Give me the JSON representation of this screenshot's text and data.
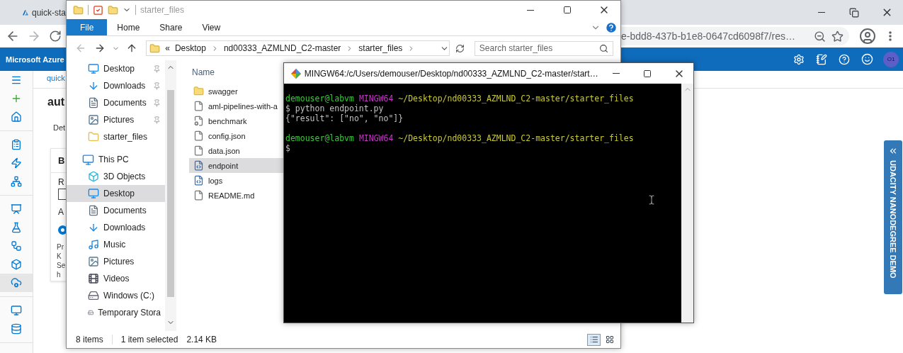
{
  "browser": {
    "tab_title": "quick-sta",
    "address": "e-bdd8-437b-b1e8-0647cd6098f7/res…"
  },
  "azure": {
    "brand": "Microsoft Azure",
    "avatar": "O1",
    "rail": [
      [
        {
          "selected": false
        },
        {
          "selected": false
        },
        {
          "selected": false
        }
      ],
      [
        {
          "selected": false
        },
        {
          "selected": false
        },
        {
          "selected": false
        }
      ],
      [
        {
          "selected": false
        },
        {
          "selected": false
        },
        {
          "selected": false
        },
        {
          "selected": false
        },
        {
          "selected": true
        }
      ],
      [
        {
          "selected": false
        },
        {
          "selected": false
        }
      ]
    ],
    "page": {
      "breadcrumb": "quick",
      "title": "aut",
      "tab": "Det",
      "card": {
        "title": "B",
        "field_label": "R",
        "option_label": "A",
        "radio": {
          "selected": true
        },
        "lines": [
          "Pr",
          "K",
          "Se",
          "h"
        ]
      }
    }
  },
  "udacity_tab": {
    "label": "UDACITY NANODEGREE DEMO"
  },
  "explorer": {
    "title": "starter_files",
    "ribbon_tabs": [
      {
        "label": "File",
        "selected": true
      },
      {
        "label": "Home",
        "selected": false
      },
      {
        "label": "Share",
        "selected": false
      },
      {
        "label": "View",
        "selected": false
      }
    ],
    "address": {
      "overflow": "«",
      "crumbs": [
        "Desktop",
        "nd00333_AZMLND_C2-master",
        "starter_files"
      ]
    },
    "search": {
      "placeholder": "Search starter_files"
    },
    "quick_access": [
      {
        "label": "Desktop",
        "kind": "desktop",
        "pinned": true,
        "selected": false
      },
      {
        "label": "Downloads",
        "kind": "download",
        "pinned": true,
        "selected": false
      },
      {
        "label": "Documents",
        "kind": "document",
        "pinned": true,
        "selected": false
      },
      {
        "label": "Pictures",
        "kind": "picture",
        "pinned": true,
        "selected": false
      },
      {
        "label": "starter_files",
        "kind": "folder",
        "pinned": false,
        "selected": false
      }
    ],
    "this_pc": {
      "label": "This PC",
      "selected": false,
      "children": [
        {
          "label": "3D Objects",
          "kind": "objects",
          "selected": false
        },
        {
          "label": "Desktop",
          "kind": "desktop",
          "selected": true
        },
        {
          "label": "Documents",
          "kind": "document",
          "selected": false
        },
        {
          "label": "Downloads",
          "kind": "download",
          "selected": false
        },
        {
          "label": "Music",
          "kind": "music",
          "selected": false
        },
        {
          "label": "Pictures",
          "kind": "picture",
          "selected": false
        },
        {
          "label": "Videos",
          "kind": "video",
          "selected": false
        },
        {
          "label": "Windows (C:)",
          "kind": "drive",
          "selected": false
        },
        {
          "label": "Temporary Stora",
          "kind": "drive",
          "selected": false
        }
      ]
    },
    "files": {
      "columns": [
        "Name"
      ],
      "rows": [
        {
          "name": "swagger",
          "kind": "folder",
          "selected": false
        },
        {
          "name": "aml-pipelines-with-a",
          "kind": "file",
          "selected": false
        },
        {
          "name": "benchmark",
          "kind": "settings",
          "selected": false
        },
        {
          "name": "config.json",
          "kind": "file",
          "selected": false
        },
        {
          "name": "data.json",
          "kind": "file",
          "selected": false
        },
        {
          "name": "endpoint",
          "kind": "python",
          "selected": true
        },
        {
          "name": "logs",
          "kind": "python",
          "selected": false
        },
        {
          "name": "README.md",
          "kind": "file",
          "selected": false
        }
      ]
    },
    "status": {
      "count": "8 items",
      "selection": "1 item selected",
      "size": "2.14 KB"
    },
    "view_modes": [
      {
        "selected": true
      },
      {
        "selected": false
      }
    ]
  },
  "terminal": {
    "title": "MINGW64:/c/Users/demouser/Desktop/nd00333_AZMLND_C2-master/start…",
    "blocks": [
      [
        [
          {
            "text": "demouser@labvm",
            "color": "#3cc83c"
          },
          {
            "text": "MINGW64",
            "color": "#c836c8"
          },
          {
            "text": "~/Desktop/nd00333_AZMLND_C2-master/starter_files",
            "color": "#c8c832"
          }
        ],
        [
          {
            "text": "$ python endpoint.py",
            "color": "#c0c0c0"
          }
        ],
        [
          {
            "text": "{\"result\": [\"no\", \"no\"]}",
            "color": "#c0c0c0"
          }
        ]
      ],
      [
        [
          {
            "text": "demouser@labvm",
            "color": "#3cc83c"
          },
          {
            "text": "MINGW64",
            "color": "#c836c8"
          },
          {
            "text": "~/Desktop/nd00333_AZMLND_C2-master/starter_files",
            "color": "#c8c832"
          }
        ],
        [
          {
            "text": "$",
            "color": "#c0c0c0"
          }
        ]
      ]
    ]
  }
}
